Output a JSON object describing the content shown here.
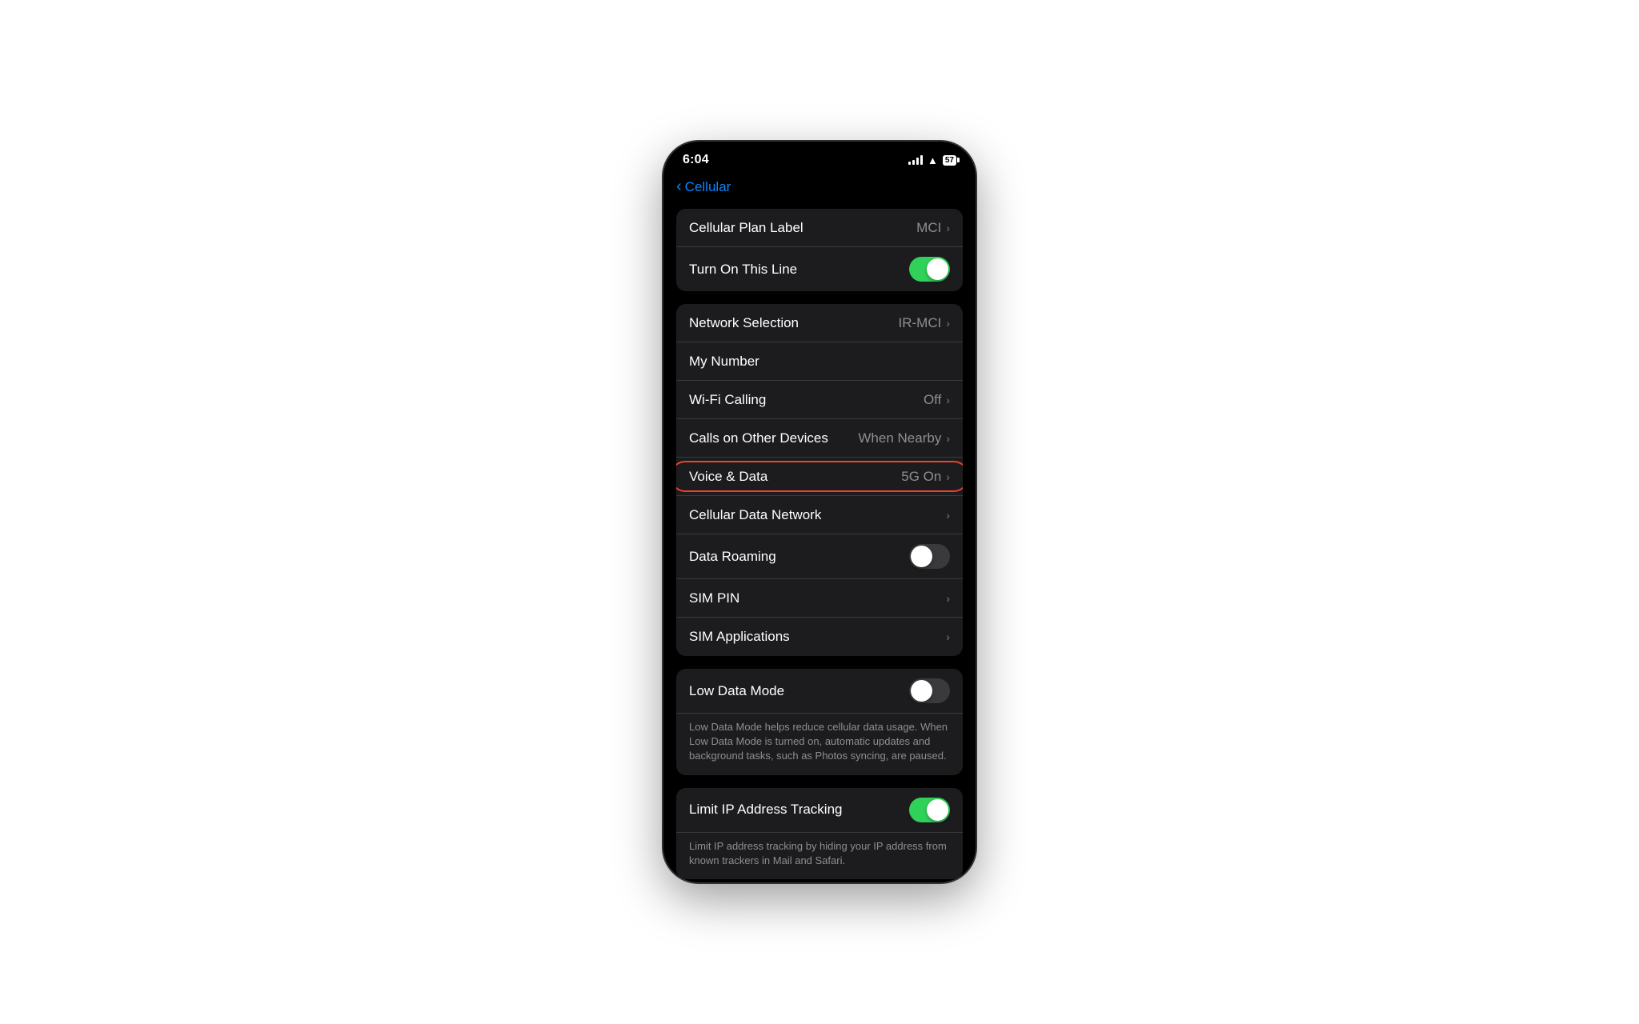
{
  "status_bar": {
    "time": "6:04",
    "battery": "57"
  },
  "nav": {
    "back_label": "Cellular",
    "back_chevron": "‹"
  },
  "groups": [
    {
      "id": "plan-group",
      "rows": [
        {
          "id": "cellular-plan-label",
          "label": "Cellular Plan Label",
          "value": "MCI",
          "type": "navigate"
        },
        {
          "id": "turn-on-this-line",
          "label": "Turn On This Line",
          "value": "",
          "type": "toggle",
          "toggle_state": "on"
        }
      ]
    },
    {
      "id": "network-group",
      "rows": [
        {
          "id": "network-selection",
          "label": "Network Selection",
          "value": "IR-MCI",
          "type": "navigate"
        },
        {
          "id": "my-number",
          "label": "My Number",
          "value": "",
          "type": "plain"
        },
        {
          "id": "wifi-calling",
          "label": "Wi-Fi Calling",
          "value": "Off",
          "type": "navigate"
        },
        {
          "id": "calls-on-other-devices",
          "label": "Calls on Other Devices",
          "value": "When Nearby",
          "type": "navigate"
        },
        {
          "id": "voice-and-data",
          "label": "Voice & Data",
          "value": "5G On",
          "type": "navigate",
          "highlighted": true
        },
        {
          "id": "cellular-data-network",
          "label": "Cellular Data Network",
          "value": "",
          "type": "navigate"
        },
        {
          "id": "data-roaming",
          "label": "Data Roaming",
          "value": "",
          "type": "toggle",
          "toggle_state": "off"
        },
        {
          "id": "sim-pin",
          "label": "SIM PIN",
          "value": "",
          "type": "navigate"
        },
        {
          "id": "sim-applications",
          "label": "SIM Applications",
          "value": "",
          "type": "navigate"
        }
      ]
    },
    {
      "id": "low-data-group",
      "rows": [
        {
          "id": "low-data-mode",
          "label": "Low Data Mode",
          "value": "",
          "type": "toggle",
          "toggle_state": "off"
        }
      ],
      "description": "Low Data Mode helps reduce cellular data usage. When Low Data Mode is turned on, automatic updates and background tasks, such as Photos syncing, are paused."
    },
    {
      "id": "limit-ip-group",
      "rows": [
        {
          "id": "limit-ip-address-tracking",
          "label": "Limit IP Address Tracking",
          "value": "",
          "type": "toggle",
          "toggle_state": "on"
        }
      ],
      "description": "Limit IP address tracking by hiding your IP address from known trackers in Mail and Safari."
    }
  ]
}
